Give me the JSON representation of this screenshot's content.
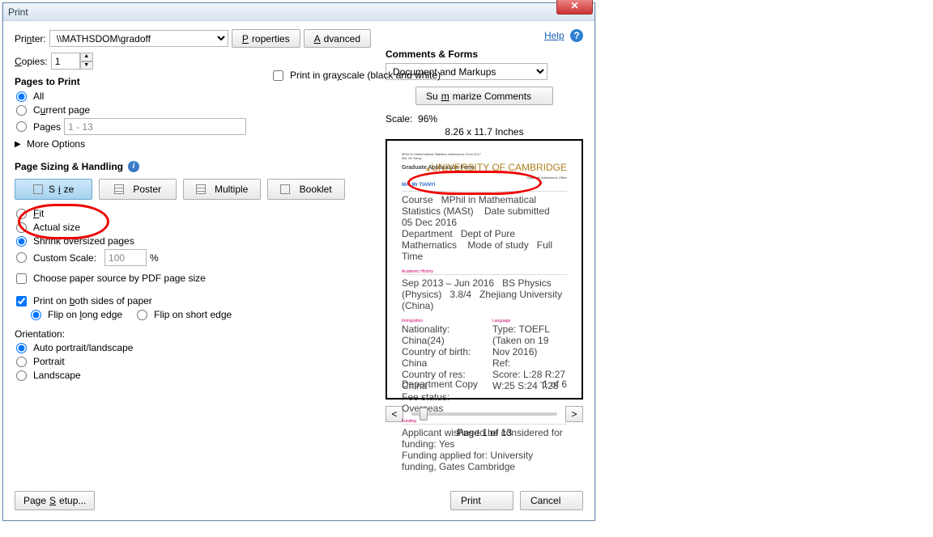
{
  "window": {
    "title": "Print"
  },
  "help": {
    "label": "Help"
  },
  "printer": {
    "label": "Printer:",
    "label_u": "n",
    "value": "\\\\MATHSDOM\\gradoff",
    "properties": "Properties",
    "properties_u": "P",
    "advanced": "Advanced",
    "advanced_u": "A"
  },
  "copies": {
    "label": "Copies:",
    "label_u": "C",
    "value": "1"
  },
  "grayscale": {
    "label": "Print in grayscale (black and white)",
    "label_u": "y"
  },
  "pages": {
    "header": "Pages to Print",
    "all": "All",
    "current": "Current page",
    "current_u": "u",
    "pages": "Pages",
    "pages_u": "g",
    "range": "1 - 13",
    "more": "More Options"
  },
  "handling": {
    "header": "Page Sizing & Handling",
    "size": "Size",
    "size_u": "i",
    "poster": "Poster",
    "multiple": "Multiple",
    "booklet": "Booklet",
    "fit": "Fit",
    "fit_u": "F",
    "actual": "Actual size",
    "shrink": "Shrink oversized pages",
    "custom": "Custom Scale:",
    "custom_val": "100",
    "pct": "%",
    "choose_paper": "Choose paper source by PDF page size",
    "both_sides": "Print on both sides of paper",
    "both_sides_u": "b",
    "flip_long": "Flip on long edge",
    "flip_long_u": "l",
    "flip_short": "Flip on short edge"
  },
  "orientation": {
    "header": "Orientation:",
    "auto": "Auto portrait/landscape",
    "portrait": "Portrait",
    "landscape": "Landscape"
  },
  "comments": {
    "header": "Comments & Forms",
    "value": "Document and Markups",
    "summarize": "Summarize Comments",
    "summarize_u": "m"
  },
  "preview": {
    "scale_label": "Scale:",
    "scale_value": "96%",
    "dimensions": "8.26 x 11.7 Inches",
    "doc_header": "Graduate Application Form",
    "doc_office": "Graduate Admissions Office",
    "logo": "UNIVERSITY OF CAMBRIDGE",
    "name": "MA, Mr TIANYI",
    "sections": [
      "Academic History",
      "Immigration",
      "Language",
      "Funding"
    ],
    "foot_left": "Department Copy",
    "foot_right": "1 of 6",
    "page_nav": "Page 1 of 13"
  },
  "footer": {
    "page_setup": "Page Setup...",
    "page_setup_u": "S",
    "print": "Print",
    "cancel": "Cancel"
  }
}
